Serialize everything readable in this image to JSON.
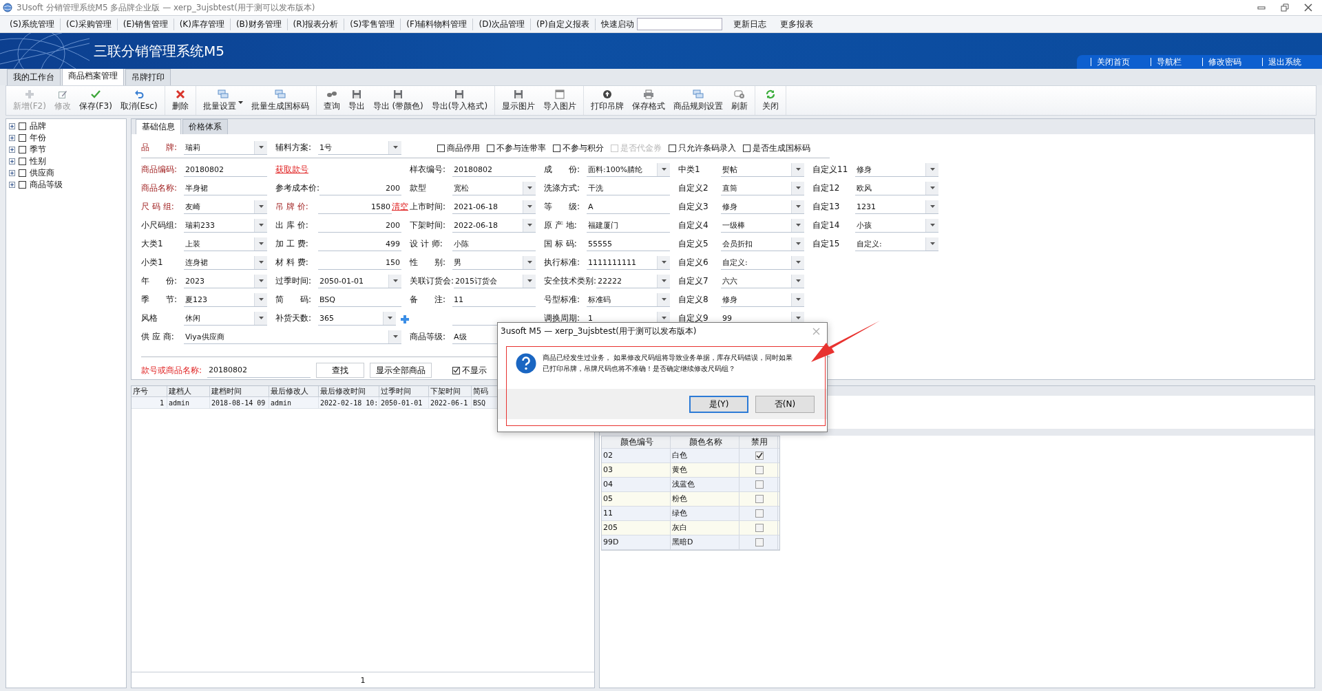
{
  "window": {
    "title": "3Usoft 分销管理系统M5 多品牌企业版 — xerp_3ujsbtest(用于测可以发布版本)"
  },
  "menu": [
    "(S)系统管理",
    "(C)采购管理",
    "(E)销售管理",
    "(K)库存管理",
    "(B)财务管理",
    "(R)报表分析",
    "(S)零售管理",
    "(F)辅料物料管理",
    "(D)次品管理",
    "(P)自定义报表"
  ],
  "quick_launch": {
    "label": "快速启动"
  },
  "menu_extra": [
    "更新日志",
    "更多报表"
  ],
  "banner": {
    "title": "三联分销管理系统M5",
    "links": [
      "关闭首页",
      "导航栏",
      "修改密码",
      "退出系统"
    ]
  },
  "tabs": [
    {
      "label": "我的工作台",
      "selected": false
    },
    {
      "label": "商品档案管理",
      "selected": true
    },
    {
      "label": "吊牌打印",
      "selected": false
    }
  ],
  "toolbar": [
    [
      {
        "label": "新增(F2)",
        "disabled": true
      },
      {
        "label": "修改",
        "disabled": true
      },
      {
        "label": "保存(F3)",
        "disabled": false
      },
      {
        "label": "取消(Esc)",
        "disabled": false
      }
    ],
    [
      {
        "label": "删除",
        "disabled": false
      }
    ],
    [
      {
        "label": "批量设置",
        "disabled": false,
        "has_menu": true
      },
      {
        "label": "批量生成国标码",
        "disabled": false
      }
    ],
    [
      {
        "label": "查询",
        "disabled": false
      },
      {
        "label": "导出",
        "disabled": false
      },
      {
        "label": "导出 (带颜色)",
        "disabled": false
      },
      {
        "label": "导出(导入格式)",
        "disabled": false
      }
    ],
    [
      {
        "label": "显示图片",
        "disabled": false
      },
      {
        "label": "导入图片",
        "disabled": false
      }
    ],
    [
      {
        "label": "打印吊牌",
        "disabled": false
      },
      {
        "label": "保存格式",
        "disabled": false
      },
      {
        "label": "商品规则设置",
        "disabled": false
      },
      {
        "label": "刷新",
        "disabled": false
      }
    ],
    [
      {
        "label": "关闭",
        "disabled": false
      }
    ]
  ],
  "tree": [
    {
      "label": "品牌",
      "checked": false
    },
    {
      "label": "年份",
      "checked": false
    },
    {
      "label": "季节",
      "checked": false
    },
    {
      "label": "性别",
      "checked": false
    },
    {
      "label": "供应商",
      "checked": false
    },
    {
      "label": "商品等级",
      "checked": false
    }
  ],
  "form": {
    "tabs": [
      {
        "label": "基础信息",
        "selected": true
      },
      {
        "label": "价格体系",
        "selected": false
      }
    ],
    "top_row": [
      {
        "label": "品　　牌:",
        "value": "瑞莉",
        "kind": "dropdown",
        "required": true
      },
      {
        "label": "辅料方案:",
        "value": "1号",
        "kind": "dropdown",
        "required": false
      }
    ],
    "options": [
      {
        "label": "商品停用",
        "checked": false,
        "disabled": false
      },
      {
        "label": "不参与连带率",
        "checked": false,
        "disabled": false
      },
      {
        "label": "不参与积分",
        "checked": false,
        "disabled": false
      },
      {
        "label": "是否代金券",
        "checked": false,
        "disabled": true
      },
      {
        "label": "只允许条码录入",
        "checked": false,
        "disabled": false
      },
      {
        "label": "是否生成国标码",
        "checked": false,
        "disabled": false
      }
    ],
    "rows": [
      [
        {
          "label": "商品编码:",
          "value": "20180802",
          "kind": "text",
          "required": true
        },
        {
          "text": "获取款号",
          "kind": "link"
        },
        {
          "label": "样衣编号:",
          "value": "20180802",
          "kind": "text",
          "required": false
        },
        {
          "label": "成　　份:",
          "value": "面料:100%腈纶",
          "kind": "dropdown",
          "required": false
        },
        {
          "label": "中类1",
          "value": "熨帖",
          "kind": "dropdown",
          "required": false
        },
        {
          "label": "自定义11",
          "value": "修身",
          "kind": "dropdown",
          "required": false
        }
      ],
      [
        {
          "label": "商品名称:",
          "value": "半身裙",
          "kind": "text",
          "required": true
        },
        {
          "label": "参考成本价:",
          "value": "200",
          "kind": "number",
          "required": false
        },
        {
          "label": "款型",
          "value": "宽松",
          "kind": "dropdown",
          "required": false
        },
        {
          "label": "洗涤方式:",
          "value": "干洗",
          "kind": "text",
          "required": false
        },
        {
          "label": "自定义2",
          "value": "直筒",
          "kind": "dropdown",
          "required": false
        },
        {
          "label": "自定12",
          "value": "欧风",
          "kind": "dropdown",
          "required": false
        }
      ],
      [
        {
          "label": "尺 码 组:",
          "value": "友崎",
          "kind": "dropdown",
          "required": true
        },
        {
          "label": "吊 牌 价:",
          "value": "1580",
          "kind": "number",
          "required": true,
          "action": "清空"
        },
        {
          "label": "上市时间:",
          "value": "2021-06-18",
          "kind": "dropdown",
          "required": false
        },
        {
          "label": "等　　级:",
          "value": "A",
          "kind": "text",
          "required": false
        },
        {
          "label": "自定义3",
          "value": "修身",
          "kind": "dropdown",
          "required": false
        },
        {
          "label": "自定13",
          "value": "1231",
          "kind": "dropdown",
          "required": false
        }
      ],
      [
        {
          "label": "小尺码组:",
          "value": "瑞莉233",
          "kind": "dropdown",
          "required": false
        },
        {
          "label": "出 库 价:",
          "value": "200",
          "kind": "number",
          "required": false
        },
        {
          "label": "下架时间:",
          "value": "2022-06-18",
          "kind": "dropdown",
          "required": false
        },
        {
          "label": "原 产 地:",
          "value": "福建厦门",
          "kind": "text",
          "required": false
        },
        {
          "label": "自定义4",
          "value": "一级棒",
          "kind": "dropdown",
          "required": false
        },
        {
          "label": "自定14",
          "value": "小孩",
          "kind": "dropdown",
          "required": false
        }
      ],
      [
        {
          "label": "大类1",
          "value": "上装",
          "kind": "dropdown",
          "required": false
        },
        {
          "label": "加 工 费:",
          "value": "499",
          "kind": "number",
          "required": false
        },
        {
          "label": "设 计 师:",
          "value": "小陈",
          "kind": "text",
          "required": false
        },
        {
          "label": "国 标 码:",
          "value": "55555",
          "kind": "text",
          "required": false
        },
        {
          "label": "自定义5",
          "value": "会员折扣",
          "kind": "dropdown",
          "required": false
        },
        {
          "label": "自定15",
          "value": "自定义:",
          "kind": "dropdown",
          "required": false
        }
      ],
      [
        {
          "label": "小类1",
          "value": "连身裙",
          "kind": "dropdown",
          "required": false
        },
        {
          "label": "材 料 费:",
          "value": "150",
          "kind": "number",
          "required": false
        },
        {
          "label": "性　　别:",
          "value": "男",
          "kind": "dropdown",
          "required": false
        },
        {
          "label": "执行标准:",
          "value": "1111111111",
          "kind": "dropdown",
          "required": false
        },
        {
          "label": "自定义6",
          "value": "自定义:",
          "kind": "dropdown",
          "required": false
        }
      ],
      [
        {
          "label": "年　　份:",
          "value": "2023",
          "kind": "dropdown",
          "required": false
        },
        {
          "label": "过季时间:",
          "value": "2050-01-01",
          "kind": "dropdown",
          "required": false
        },
        {
          "label": "关联订货会:",
          "value": "2015订货会",
          "kind": "dropdown",
          "required": false
        },
        {
          "label": "安全技术类别:",
          "value": "22222",
          "kind": "dropdown",
          "required": false
        },
        {
          "label": "自定义7",
          "value": "六六",
          "kind": "dropdown",
          "required": false
        }
      ],
      [
        {
          "label": "季　　节:",
          "value": "夏123",
          "kind": "dropdown",
          "required": false
        },
        {
          "label": "简　　码:",
          "value": "BSQ",
          "kind": "text",
          "required": false
        },
        {
          "label": "备　　注:",
          "value": "11",
          "kind": "text",
          "required": false
        },
        {
          "label": "号型标准:",
          "value": "标准码",
          "kind": "dropdown",
          "required": false
        },
        {
          "label": "自定义8",
          "value": "修身",
          "kind": "dropdown",
          "required": false
        }
      ],
      [
        {
          "label": "风格",
          "value": "休闲",
          "kind": "dropdown",
          "required": false
        },
        {
          "label": "补货天数:",
          "value": "365",
          "kind": "dropdown",
          "required": false,
          "add_button": true
        },
        {
          "kind": "blank"
        },
        {
          "label": "调换周期:",
          "value": "1",
          "kind": "dropdown",
          "required": false
        },
        {
          "label": "自定义9",
          "value": "99",
          "kind": "dropdown",
          "required": false
        }
      ],
      [
        {
          "label": "供 应 商:",
          "value": "Viya供应商",
          "kind": "dropdown",
          "required": false
        },
        "",
        {
          "label": "商品等级:",
          "value": "A级",
          "kind": "text",
          "required": false
        }
      ]
    ],
    "search": {
      "label": "款号或商品名称:",
      "value": "20180802",
      "buttons": [
        "查找",
        "显示全部商品"
      ],
      "option": {
        "label": "不显示",
        "checked": true
      }
    }
  },
  "list": {
    "columns": [
      "序号",
      "建档人",
      "建档时间",
      "最后修改人",
      "最后修改时间",
      "过季时间",
      "下架时间",
      "简码"
    ],
    "rows": [
      [
        "1",
        "admin",
        "2018-08-14 09",
        "admin",
        "2022-02-18 10:",
        "2050-01-01",
        "2022-06-1",
        "BSQ"
      ]
    ],
    "page": "1"
  },
  "colors": {
    "columns": [
      "颜色编号",
      "颜色名称",
      "禁用"
    ],
    "rows": [
      {
        "code": "02",
        "name": "白色",
        "disabled": true
      },
      {
        "code": "03",
        "name": "黄色",
        "disabled": false
      },
      {
        "code": "04",
        "name": "浅蓝色",
        "disabled": false
      },
      {
        "code": "05",
        "name": "粉色",
        "disabled": false
      },
      {
        "code": "11",
        "name": "绿色",
        "disabled": false
      },
      {
        "code": "205",
        "name": "灰白",
        "disabled": false
      },
      {
        "code": "99D",
        "name": "黑暗D",
        "disabled": false
      }
    ]
  },
  "dialog": {
    "title": "3usoft M5 — xerp_3ujsbtest(用于测可以发布版本)",
    "message": "商品已经发生过业务， 如果修改尺码组将导致业务单据，库存尺码错误，同时如果已打印吊牌，吊牌尺码也将不准确！是否确定继续修改尺码组？",
    "buttons": [
      {
        "label": "是(Y)",
        "selected": true
      },
      {
        "label": "否(N)",
        "selected": false
      }
    ]
  }
}
